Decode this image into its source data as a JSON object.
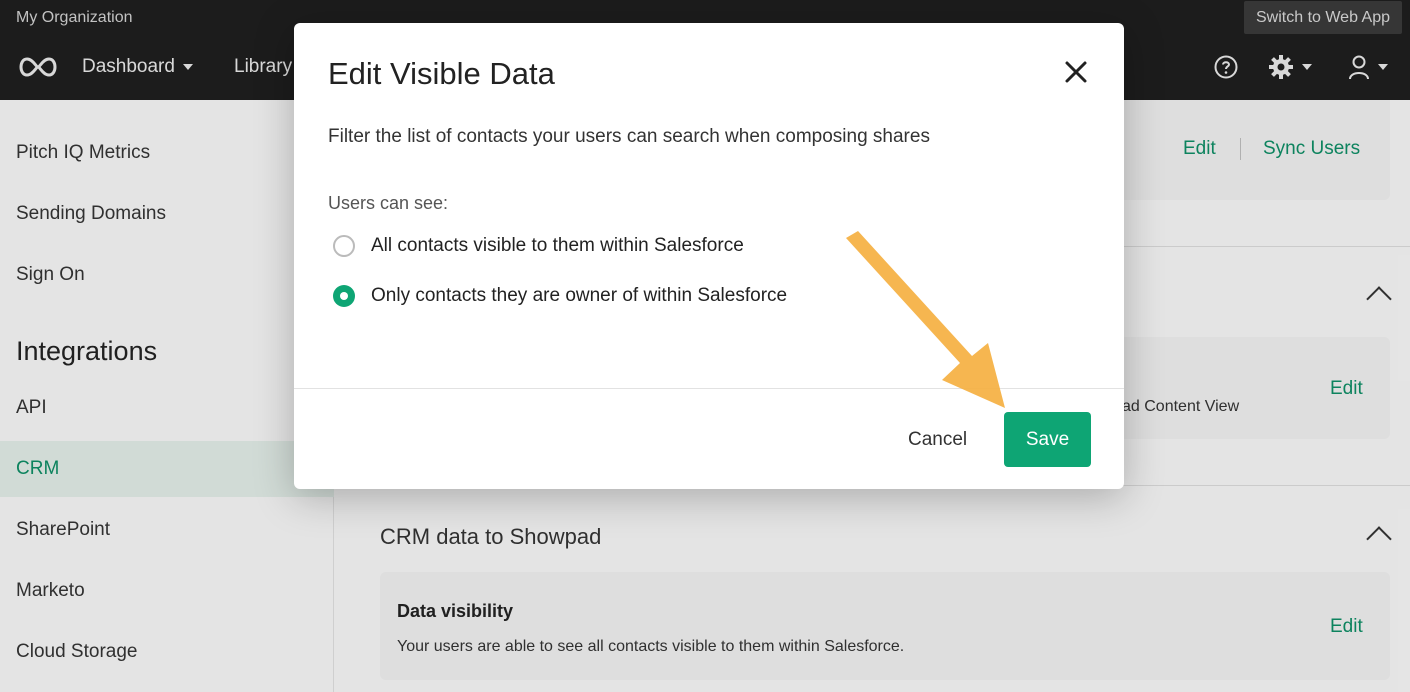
{
  "topbar": {
    "org_name": "My Organization",
    "switch_label": "Switch to Web App",
    "nav": [
      {
        "label": "Dashboard"
      },
      {
        "label": "Library"
      }
    ],
    "icons": [
      "help-icon",
      "gear-icon",
      "user-icon"
    ]
  },
  "sidebar": {
    "items": [
      {
        "label": "Pitch IQ Metrics"
      },
      {
        "label": "Sending Domains"
      },
      {
        "label": "Sign On"
      },
      {
        "label": "API"
      },
      {
        "label": "CRM"
      },
      {
        "label": "SharePoint"
      },
      {
        "label": "Marketo"
      },
      {
        "label": "Cloud Storage"
      }
    ],
    "heading": "Integrations",
    "active": "CRM"
  },
  "main": {
    "top_card": {
      "edit_label": "Edit",
      "sync_label": "Sync Users"
    },
    "mid_card": {
      "text": "ad Content View",
      "edit_label": "Edit"
    },
    "section_title": "CRM data to Showpad",
    "bottom_card": {
      "title": "Data visibility",
      "text": "Your users are able to see all contacts visible to them within Salesforce.",
      "edit_label": "Edit"
    }
  },
  "modal": {
    "title": "Edit Visible Data",
    "description": "Filter the list of contacts your users can search when composing shares",
    "label": "Users can see:",
    "options": [
      {
        "label": "All contacts visible to them within Salesforce",
        "checked": false
      },
      {
        "label": "Only contacts they are owner of within Salesforce",
        "checked": true
      }
    ],
    "cancel_label": "Cancel",
    "save_label": "Save"
  },
  "colors": {
    "accent": "#0ea574",
    "link": "#0e8c64",
    "topbar": "#1e1e1e",
    "arrow": "#f5b041"
  }
}
